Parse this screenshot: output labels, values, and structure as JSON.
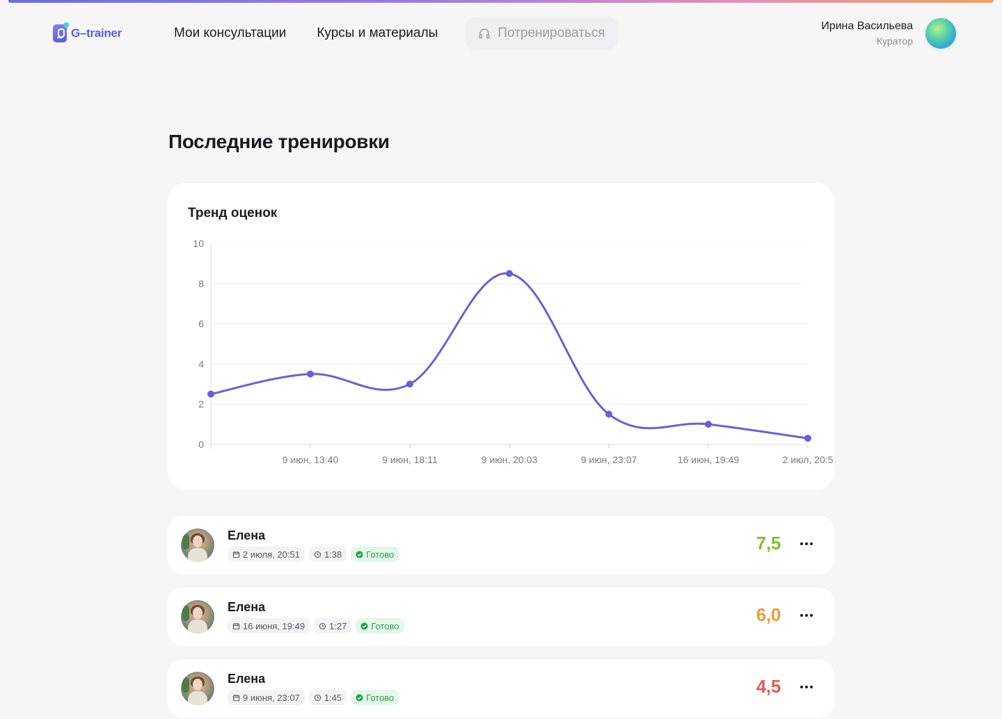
{
  "app": {
    "logo_text": "G–trainer",
    "accent": "#5b5cd6"
  },
  "nav": {
    "items": [
      {
        "label": "Мои консультации"
      },
      {
        "label": "Курсы и материалы"
      }
    ],
    "train_label": "Потренироваться",
    "train_icon": "headphones-icon"
  },
  "user": {
    "name": "Ирина Васильева",
    "role": "Куратор"
  },
  "page": {
    "title": "Последние тренировки"
  },
  "chart_data": {
    "type": "line",
    "title": "Тренд оценок",
    "xlabel": "",
    "ylabel": "",
    "ylim": [
      0,
      10
    ],
    "y_ticks": [
      0,
      2,
      4,
      6,
      8,
      10
    ],
    "grid": true,
    "legend": "none",
    "x": [
      "",
      "9 июн, 13:40",
      "9 июн, 18:11",
      "9 июн, 20:03",
      "9 июн, 23:07",
      "16 июн, 19:49",
      "2 июл, 20:5"
    ],
    "series": [
      {
        "values": [
          2.5,
          3.5,
          3.0,
          8.5,
          1.5,
          1.0,
          0.3
        ],
        "color": "#6462d8"
      }
    ]
  },
  "trainings": [
    {
      "name": "Елена",
      "date": "2 июля, 20:51",
      "duration": "1:38",
      "status": "Готово",
      "score": "7,5",
      "score_color": "#7ec32b"
    },
    {
      "name": "Елена",
      "date": "16 июня, 19:49",
      "duration": "1:27",
      "status": "Готово",
      "score": "6,0",
      "score_color": "#ef9a3c"
    },
    {
      "name": "Елена",
      "date": "9 июня, 23:07",
      "duration": "1:45",
      "status": "Готово",
      "score": "4,5",
      "score_color": "#e65a4f"
    }
  ]
}
